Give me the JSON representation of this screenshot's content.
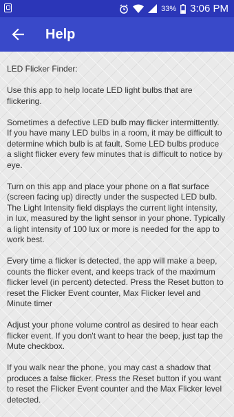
{
  "status_bar": {
    "battery_pct": "33%",
    "time": "3:06 PM"
  },
  "app_bar": {
    "title": "Help",
    "back_icon": "arrow-left-icon"
  },
  "help": {
    "heading": "LED Flicker Finder:",
    "p1": " Use this app to help locate LED light bulbs that are flickering.",
    "p2": " Sometimes a defective LED bulb may flicker intermittently. If you have many LED bulbs in a room, it may be difficult to determine which bulb is at fault. Some LED bulbs produce a slight flicker every few minutes that is difficult to notice by eye.",
    "p3": " Turn on this app and place your phone on a flat surface (screen facing up) directly under the suspected LED bulb. The Light Intensity field displays the current light intensity, in lux, measured by the light sensor in your phone. Typically a light intensity of 100 lux or more is needed for the app to work best.",
    "p4": " Every time a flicker is detected, the app will make a beep, counts the flicker event, and keeps track of the maximum flicker level (in percent) detected. Press the Reset button to reset the Flicker Event counter, Max Flicker level and Minute timer",
    "p5": " Adjust your phone volume control as desired to hear each flicker event. If you don't want to hear the beep, just tap the Mute checkbox.",
    "p6": " If you walk near the phone, you may cast a shadow that produces a false flicker. Press the Reset button if you want to reset the Flicker Event counter and the Max Flicker level detected."
  }
}
